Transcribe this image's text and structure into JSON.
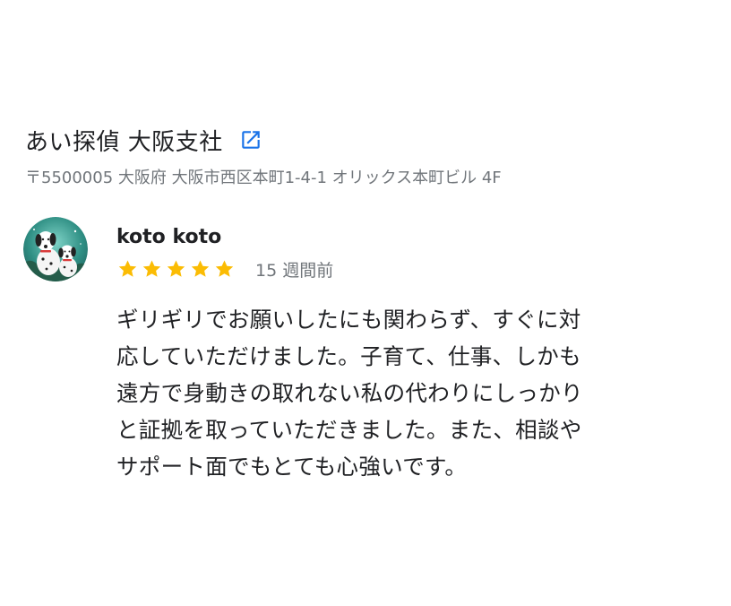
{
  "place": {
    "name": "あい探偵 大阪支社",
    "address": "〒5500005 大阪府 大阪市西区本町1-4-1 オリックス本町ビル 4F",
    "link_icon": "external-link-icon"
  },
  "review": {
    "author": "koto koto",
    "avatar_icon": "dalmatian-avatar",
    "rating": 5,
    "rating_max": 5,
    "date": "15 週間前",
    "text_lines": [
      "ギリギリでお願いしたにも関わらず、すぐに対",
      "応していただけました。子育て、仕事、しかも",
      "遠方で身動きの取れない私の代わりにしっかり",
      "と証拠を取っていただきました。また、相談や",
      "サポート面でもとても心強いです。"
    ]
  },
  "colors": {
    "star": "#fbbc04",
    "link": "#1a73e8",
    "secondary_text": "#70757a",
    "primary_text": "#202124"
  }
}
